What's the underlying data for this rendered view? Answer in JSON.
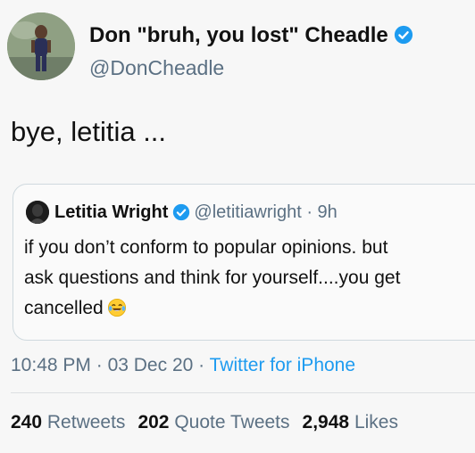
{
  "author": {
    "display_name": "Don \"bruh, you lost\" Cheadle",
    "handle": "@DonCheadle",
    "avatar_icon": "person-photo-avatar",
    "verified_icon": "verified-badge-icon"
  },
  "tweet": {
    "text": "bye, letitia ..."
  },
  "quoted_tweet": {
    "display_name": "Letitia Wright",
    "handle": "@letitiawright",
    "separator": "·",
    "time": "9h",
    "lines": [
      "if you don’t conform to popular opinions. but",
      "ask questions and think for yourself....you get",
      "cancelled"
    ],
    "emoji_icon": "tears-of-joy-emoji"
  },
  "meta": {
    "time": "10:48 PM",
    "separator": "·",
    "date": "03 Dec 20",
    "source": "Twitter for iPhone"
  },
  "stats": {
    "retweets": {
      "count": "240",
      "label": "Retweets"
    },
    "quotes": {
      "count": "202",
      "label": "Quote Tweets"
    },
    "likes": {
      "count": "2,948",
      "label": "Likes"
    }
  },
  "colors": {
    "verified_blue": "#1d9bf0",
    "secondary_text": "#5b7083",
    "link": "#1d9bf0",
    "background": "#f7f7f7"
  }
}
